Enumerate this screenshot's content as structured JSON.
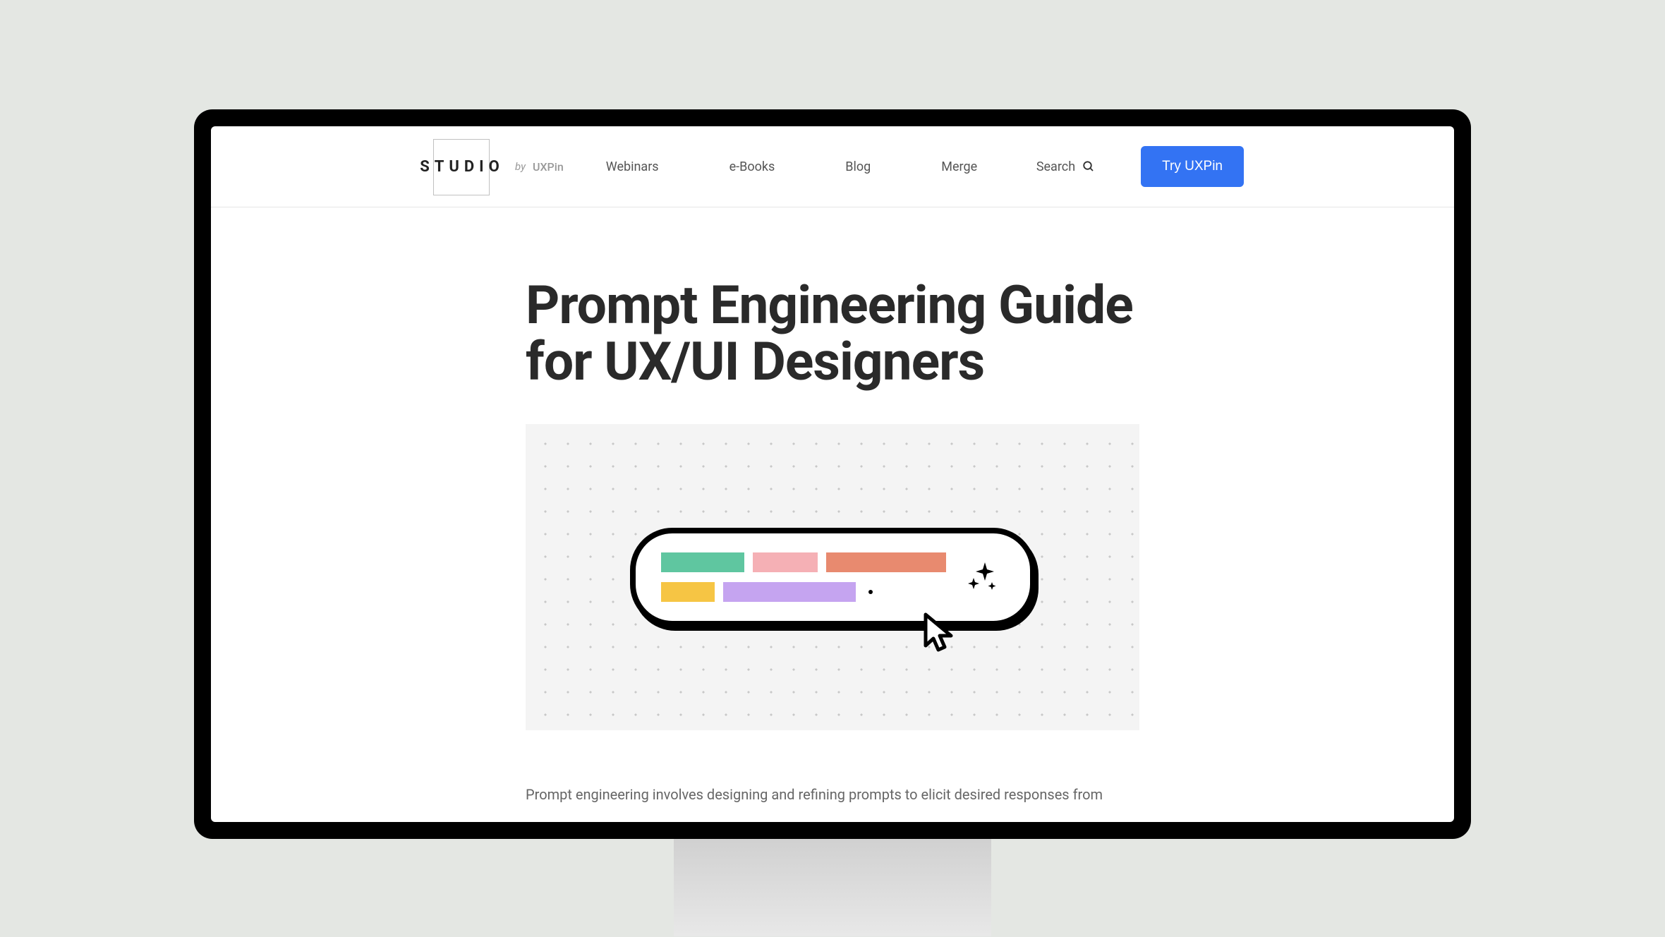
{
  "logo": {
    "main": "STUDIO",
    "sub": "by",
    "brand": "UXPin"
  },
  "nav": {
    "items": [
      "Webinars",
      "e-Books",
      "Blog",
      "Merge"
    ],
    "search_label": "Search"
  },
  "cta": {
    "label": "Try UXPin"
  },
  "article": {
    "title": "Prompt Engineering Guide for UX/UI Designers",
    "body_preview": "Prompt engineering involves designing and refining prompts to elicit desired responses from"
  },
  "hero": {
    "chip_colors": [
      "green",
      "pink",
      "orange",
      "yellow",
      "purple"
    ],
    "icon": "sparkle-icon"
  }
}
